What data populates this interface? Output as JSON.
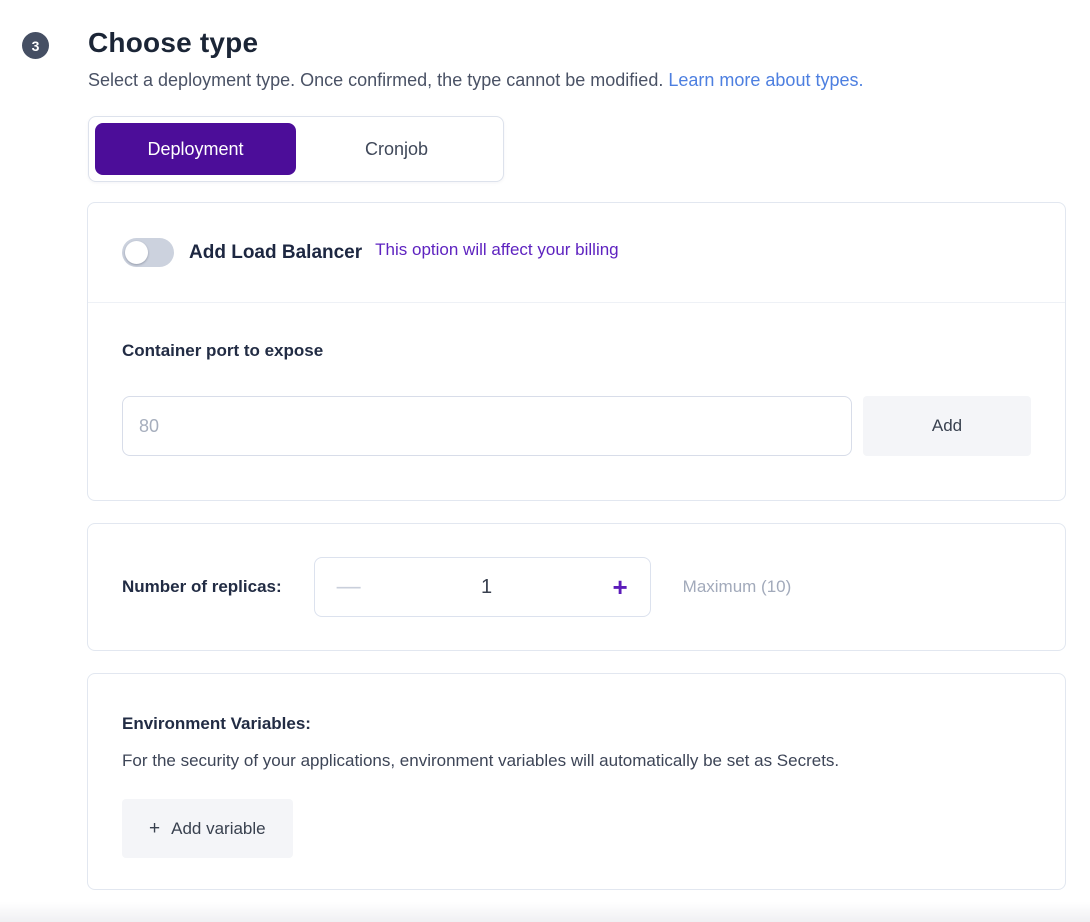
{
  "colors": {
    "accent_purple": "#4C0D99",
    "billing_purple": "#5E23C0",
    "link_blue": "#4D7FE0",
    "step_badge_slate": "#454F63",
    "button_gray_bg": "#F4F5F8"
  },
  "header": {
    "step_number": "3",
    "title": "Choose type",
    "subtitle": "Select a deployment type. Once confirmed, the type cannot be modified.",
    "link_label": "Learn more about types."
  },
  "tabs": [
    {
      "label": "Deployment",
      "selected": true
    },
    {
      "label": "Cronjob",
      "selected": false
    }
  ],
  "load_balancer": {
    "label": "Add Load Balancer",
    "toggle_state": "off",
    "billing_note": "This option will affect your billing"
  },
  "container_port": {
    "label": "Container port to expose",
    "placeholder": "80",
    "value": "",
    "add_button_label": "Add"
  },
  "replicas": {
    "label": "Number of replicas:",
    "minus_glyph": "—",
    "value": "1",
    "plus_glyph": "+",
    "max_note": "Maximum (10)"
  },
  "environment_variables": {
    "title": "Environment Variables:",
    "description": "For the security of your applications, environment variables will automatically be set as Secrets.",
    "add_button_plus": "+",
    "add_button_label": "Add variable"
  }
}
